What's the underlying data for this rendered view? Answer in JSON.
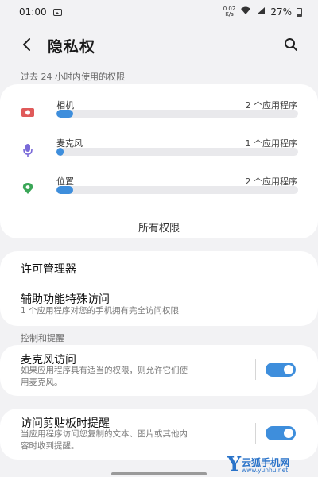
{
  "status_bar": {
    "time": "01:00",
    "net_speed_value": "0.02",
    "net_speed_unit": "K/s",
    "battery": "27%"
  },
  "header": {
    "title": "隐私权"
  },
  "usage_section": {
    "label": "过去 24 小时内使用的权限",
    "items": [
      {
        "name": "相机",
        "count": "2 个应用程序",
        "icon": "camera-icon",
        "color": "#e05a5a",
        "usage": 0.07
      },
      {
        "name": "麦克风",
        "count": "1 个应用程序",
        "icon": "microphone-icon",
        "color": "#7a6ad8",
        "usage": 0.03
      },
      {
        "name": "位置",
        "count": "2 个应用程序",
        "icon": "location-icon",
        "color": "#3aa657",
        "usage": 0.07
      }
    ],
    "all_permissions": "所有权限"
  },
  "manage_section": {
    "permission_manager": "许可管理器",
    "accessibility_title": "辅助功能特殊访问",
    "accessibility_sub": "1 个应用程序对您的手机拥有完全访问权限"
  },
  "controls_section": {
    "label": "控制和提醒",
    "mic_access_title": "麦克风访问",
    "mic_access_sub_1": "如果应用程序具有适当的权限，则允许它们使",
    "mic_access_sub_2": "用麦克风。",
    "mic_access_on": true,
    "clipboard_title": "访问剪贴板时提醒",
    "clipboard_sub_1": "当应用程序访问您复制的文本、图片或其他内",
    "clipboard_sub_2": "容时收到提醒。",
    "clipboard_on": true,
    "accent": "#3e8edc"
  },
  "watermark": {
    "letter": "Y",
    "name": "云狐手机网",
    "url": "www.yunhu.net"
  }
}
